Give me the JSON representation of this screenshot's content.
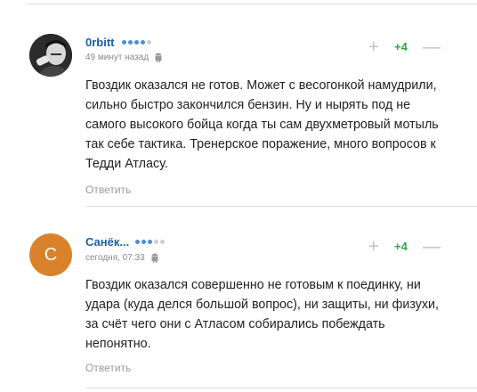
{
  "comments": [
    {
      "author": "0rbitt",
      "time": "49 минут назад",
      "score": "+4",
      "plus": "+",
      "minus": "—",
      "text": "Гвоздик оказался не готов. Может с весогонкой намудрили, сильно быстро закончился бензин. Ну и нырять под не самого высокого бойца когда ты сам двухметровый мотыль так себе тактика. Тренерское поражение, много вопросов к Тедди Атласу.",
      "reply": "Ответить",
      "rating_dots": [
        "#4a90d9",
        "#4a90d9",
        "#4a90d9",
        "#4a90d9",
        "#cfcfcf"
      ],
      "platform_icon": "android-icon"
    },
    {
      "author": "Санёк...",
      "avatar_letter": "С",
      "time": "сегодня, 07:33",
      "score": "+4",
      "plus": "+",
      "minus": "—",
      "text": "Гвоздик оказался совершенно не готовым к поединку, ни удара (куда делся большой вопрос), ни защиты, ни физухи, за счёт чего они с Атласом собирались побеждать непонятно.",
      "reply": "Ответить",
      "rating_dots": [
        "#4a90d9",
        "#4a90d9",
        "#4a90d9",
        "#cfcfcf",
        "#cfcfcf"
      ],
      "platform_icon": "android-icon"
    }
  ],
  "colors": {
    "author": "#1b5e9c",
    "score": "#2eaa3c",
    "avatar_bg": "#d9822b"
  }
}
